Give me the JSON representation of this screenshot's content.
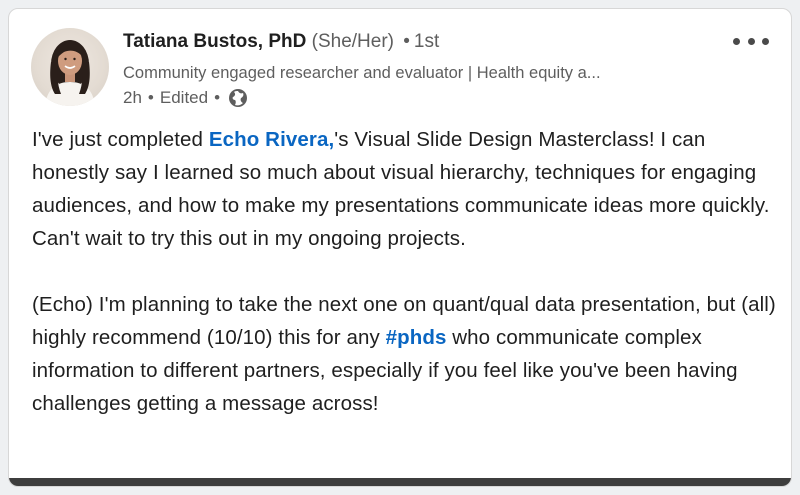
{
  "author": {
    "name": "Tatiana Bustos, PhD",
    "pronouns": "(She/Her)",
    "separator": "•",
    "degree": "1st",
    "headline": "Community engaged researcher and evaluator | Health equity a...",
    "time": "2h",
    "edited": "Edited",
    "meta_separator": "•"
  },
  "post": {
    "p1_before": "I've just completed ",
    "p1_mention": "Echo Rivera,",
    "p1_after": "'s Visual Slide Design Masterclass! I can honestly say I learned so much about visual hierarchy, techniques for engaging audiences, and how to make my presentations communicate ideas more quickly. Can't wait to try this out in my ongoing projects.",
    "p2_before": "(Echo) I'm planning to take the next one on quant/qual data presentation, but (all) highly recommend (10/10) this for any ",
    "p2_hashtag": "#phds",
    "p2_after": " who communicate complex information to different partners, especially if you feel like you've been having challenges getting a message across!"
  },
  "icons": {
    "more": "more-options-icon",
    "globe": "globe-icon"
  },
  "colors": {
    "link": "#0a66c2",
    "text": "#1f1f1f",
    "muted": "#5e5e5e",
    "card_border": "#d7d7d7"
  }
}
